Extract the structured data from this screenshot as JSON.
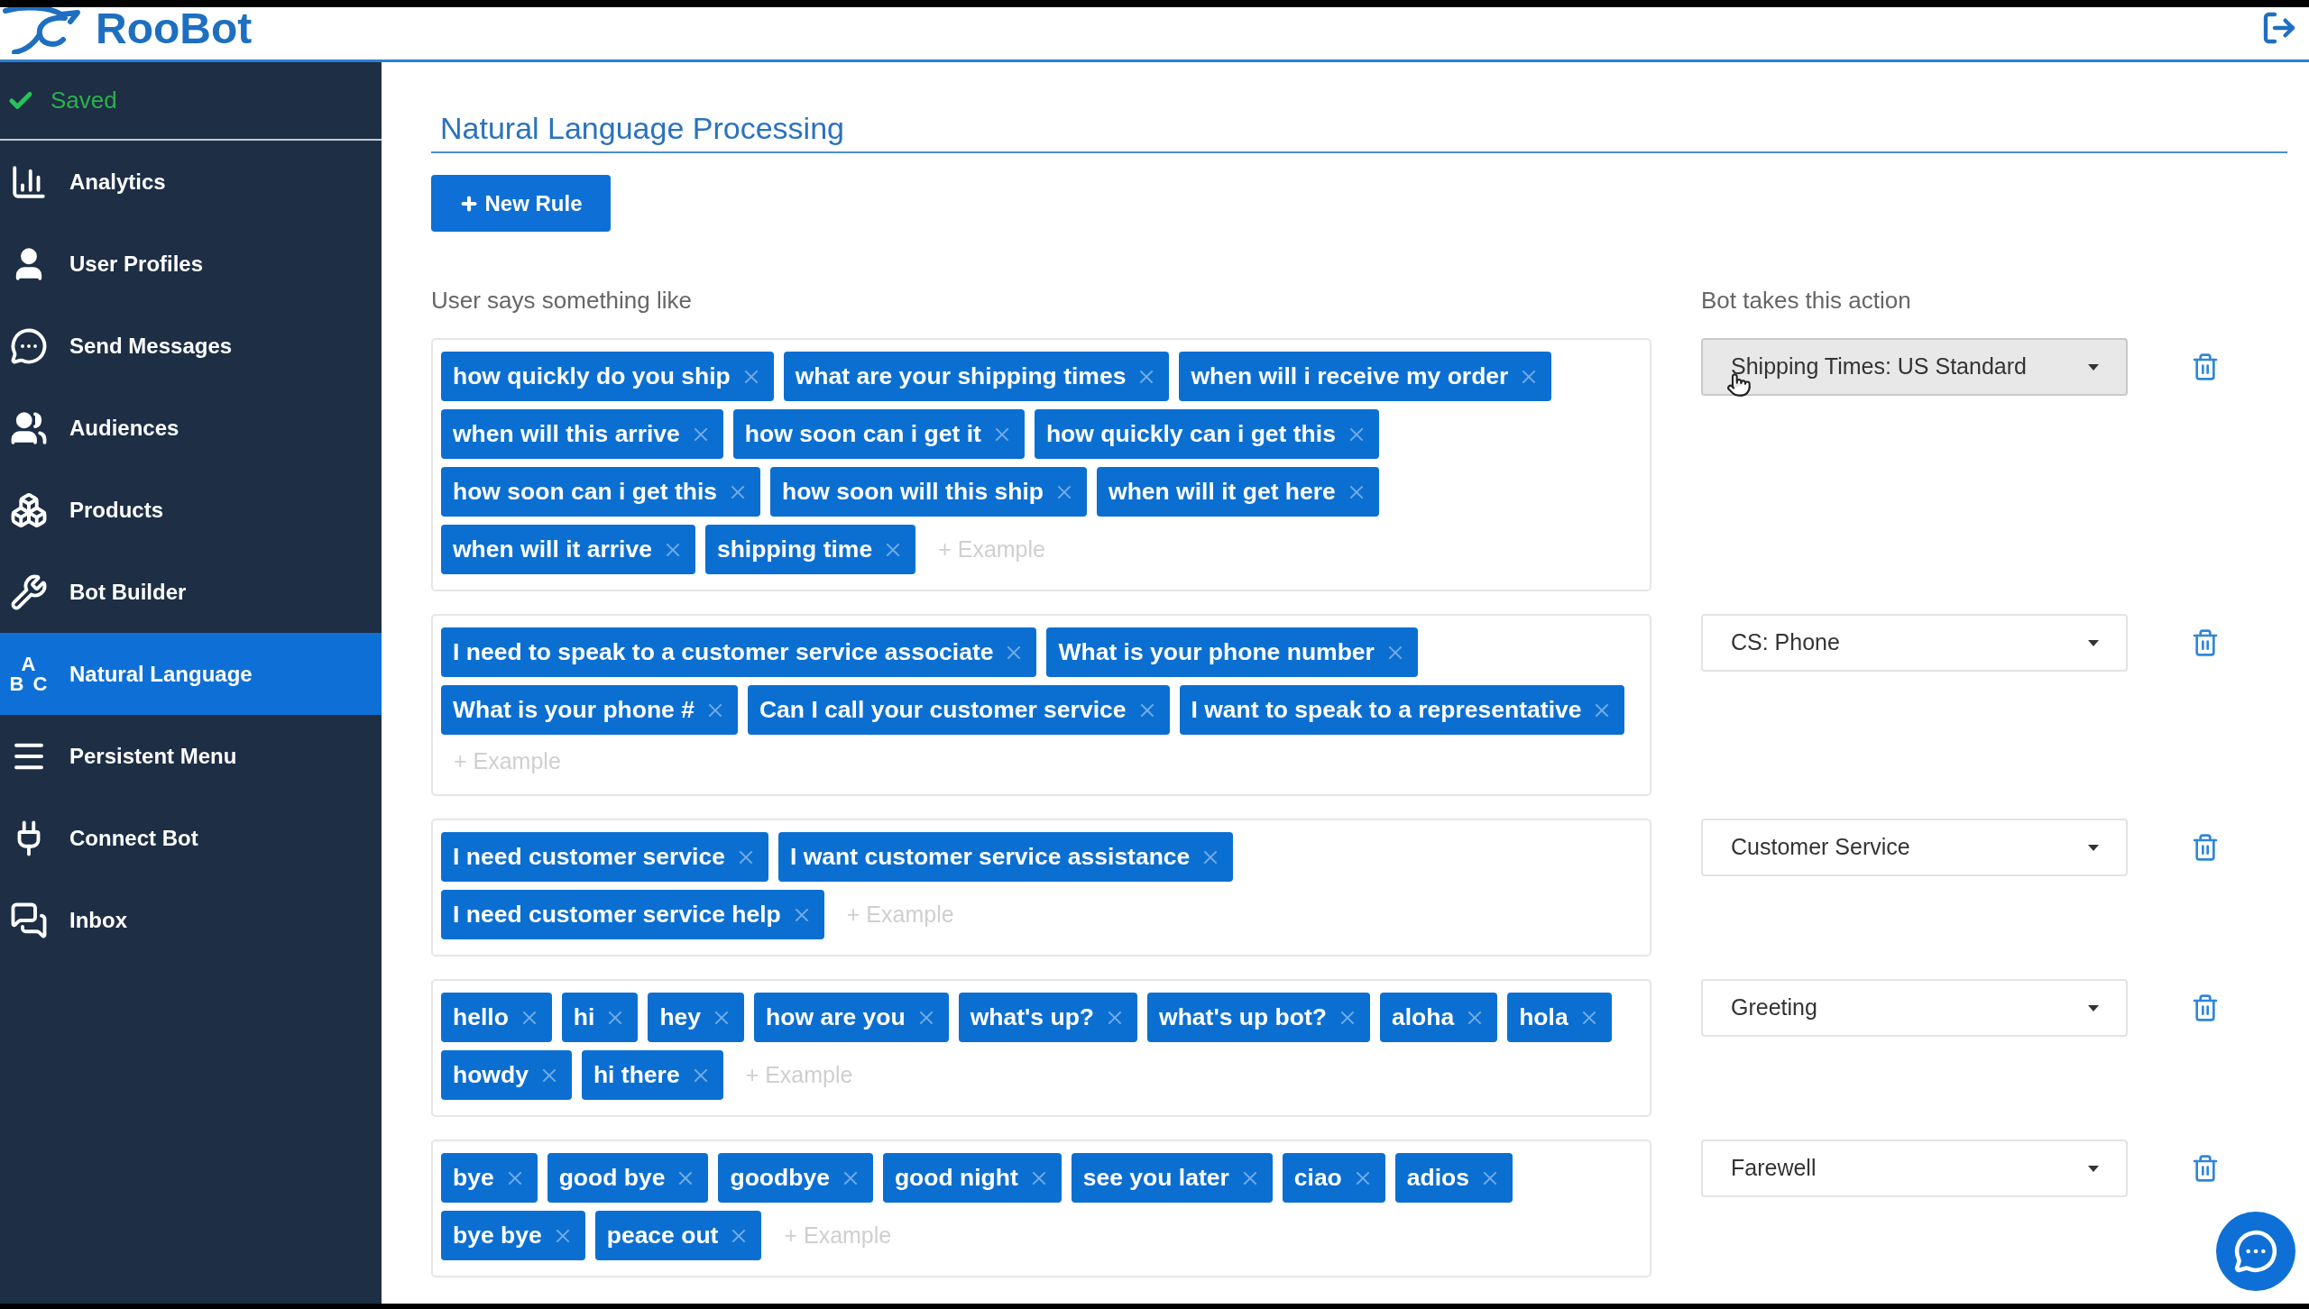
{
  "header": {
    "logo_text": "RooBot"
  },
  "sidebar": {
    "status": "Saved",
    "items": [
      {
        "label": "Analytics",
        "selected": false
      },
      {
        "label": "User Profiles",
        "selected": false
      },
      {
        "label": "Send Messages",
        "selected": false
      },
      {
        "label": "Audiences",
        "selected": false
      },
      {
        "label": "Products",
        "selected": false
      },
      {
        "label": "Bot Builder",
        "selected": false
      },
      {
        "label": "Natural Language",
        "selected": true,
        "icon_letters": [
          "A",
          "B",
          "C"
        ]
      },
      {
        "label": "Persistent Menu",
        "selected": false
      },
      {
        "label": "Connect Bot",
        "selected": false
      },
      {
        "label": "Inbox",
        "selected": false
      }
    ]
  },
  "page": {
    "title": "Natural Language Processing",
    "new_rule_button": "New Rule",
    "user_column_label": "User says something like",
    "bot_column_label": "Bot takes this action"
  },
  "rules": [
    {
      "examples": [
        "how quickly do you ship",
        "what are your shipping times",
        "when will i receive my order",
        "when will this arrive",
        "how soon can i get it",
        "how quickly can i get this",
        "how soon can i get this",
        "how soon will this ship",
        "when will it get here",
        "when will it arrive",
        "shipping time"
      ],
      "example_placeholder": "+ Example",
      "action": "Shipping Times: US Standard",
      "hovered": true
    },
    {
      "examples": [
        "I need to speak to a customer service associate",
        "What is your phone number",
        "What is your phone #",
        "Can I call your customer service",
        "I want to speak to a representative"
      ],
      "example_placeholder": "+ Example",
      "action": "CS: Phone",
      "hovered": false
    },
    {
      "examples": [
        "I need customer service",
        "I want customer service assistance",
        "I need customer service help"
      ],
      "example_placeholder": "+ Example",
      "action": "Customer Service",
      "hovered": false
    },
    {
      "examples": [
        "hello",
        "hi",
        "hey",
        "how are you",
        "what's up?",
        "what's up bot?",
        "aloha",
        "hola",
        "howdy",
        "hi there"
      ],
      "example_placeholder": "+ Example",
      "action": "Greeting",
      "hovered": false
    },
    {
      "examples": [
        "bye",
        "good bye",
        "goodbye",
        "good night",
        "see you later",
        "ciao",
        "adios",
        "bye bye",
        "peace out"
      ],
      "example_placeholder": "+ Example",
      "action": "Farewell",
      "hovered": false
    }
  ]
}
